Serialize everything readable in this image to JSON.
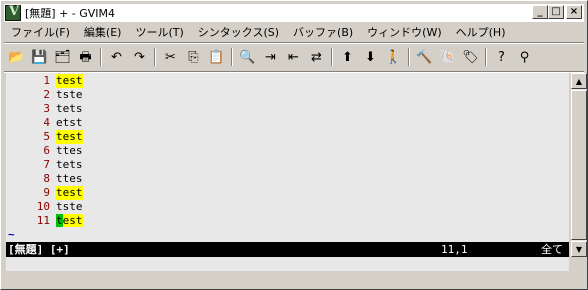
{
  "window": {
    "title": "[無題] + - GVIM4",
    "minimize": "_",
    "maximize": "□",
    "close": "×"
  },
  "menu": [
    "ファイル(F)",
    "編集(E)",
    "ツール(T)",
    "シンタックス(S)",
    "バッファ(B)",
    "ウィンドウ(W)",
    "ヘルプ(H)"
  ],
  "toolbar": {
    "groups": [
      [
        {
          "name": "open-icon",
          "glyph": "📂"
        },
        {
          "name": "save-icon",
          "glyph": "💾"
        },
        {
          "name": "save-all-icon",
          "glyph": "🗂"
        },
        {
          "name": "print-icon",
          "glyph": "🖶"
        }
      ],
      [
        {
          "name": "undo-icon",
          "glyph": "↶"
        },
        {
          "name": "redo-icon",
          "glyph": "↷"
        }
      ],
      [
        {
          "name": "cut-icon",
          "glyph": "✂"
        },
        {
          "name": "copy-icon",
          "glyph": "⎘"
        },
        {
          "name": "paste-icon",
          "glyph": "📋"
        }
      ],
      [
        {
          "name": "find-icon",
          "glyph": "🔍"
        },
        {
          "name": "find-next-icon",
          "glyph": "⇥"
        },
        {
          "name": "find-prev-icon",
          "glyph": "⇤"
        },
        {
          "name": "replace-icon",
          "glyph": "⇄"
        }
      ],
      [
        {
          "name": "load-session-icon",
          "glyph": "⬆"
        },
        {
          "name": "save-session-icon",
          "glyph": "⬇"
        },
        {
          "name": "run-script-icon",
          "glyph": "🚶"
        }
      ],
      [
        {
          "name": "make-icon",
          "glyph": "🔨"
        },
        {
          "name": "shell-icon",
          "glyph": "🐚"
        },
        {
          "name": "tag-icon",
          "glyph": "🏷"
        }
      ],
      [
        {
          "name": "help-icon",
          "glyph": "?"
        },
        {
          "name": "find-help-icon",
          "glyph": "⚲"
        }
      ]
    ]
  },
  "editor": {
    "lines": [
      {
        "num": "1",
        "text": "test",
        "highlight": true
      },
      {
        "num": "2",
        "text": "tste",
        "highlight": false
      },
      {
        "num": "3",
        "text": "tets",
        "highlight": false
      },
      {
        "num": "4",
        "text": "etst",
        "highlight": false
      },
      {
        "num": "5",
        "text": "test",
        "highlight": true
      },
      {
        "num": "6",
        "text": "ttes",
        "highlight": false
      },
      {
        "num": "7",
        "text": "tets",
        "highlight": false
      },
      {
        "num": "8",
        "text": "ttes",
        "highlight": false
      },
      {
        "num": "9",
        "text": "test",
        "highlight": true
      },
      {
        "num": "10",
        "text": "tste",
        "highlight": false
      },
      {
        "num": "11",
        "text": "test",
        "highlight": true,
        "cursor": true
      }
    ],
    "tilde": "~",
    "highlight_color": "#ffff00",
    "cursor_color": "#00c000",
    "linenumber_color": "#8b0000"
  },
  "status": {
    "file": "[無題] [+]",
    "position": "11,1",
    "percent": "全て"
  }
}
